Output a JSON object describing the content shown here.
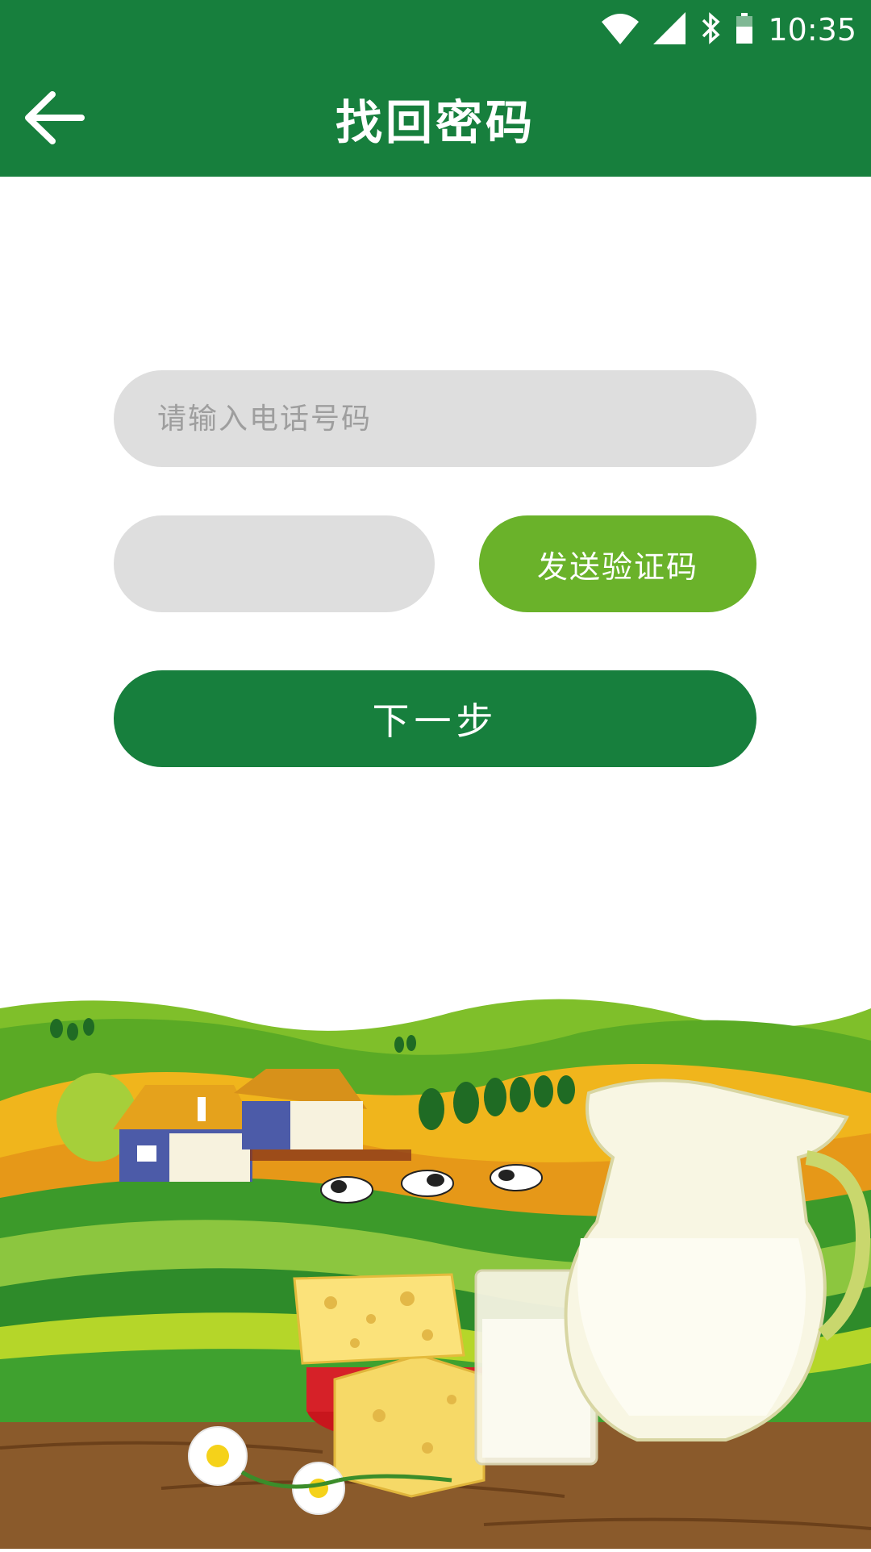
{
  "status_bar": {
    "time": "10:35",
    "icons": [
      "wifi-icon",
      "cell-signal-icon",
      "bluetooth-icon",
      "battery-icon"
    ]
  },
  "app_bar": {
    "title": "找回密码",
    "back_icon": "arrow-left-icon"
  },
  "form": {
    "phone_placeholder": "请输入电话号码",
    "phone_value": "",
    "code_placeholder": "",
    "code_value": "",
    "send_code_label": "发送验证码",
    "next_label": "下一步"
  },
  "colors": {
    "primary": "#177f3d",
    "accent": "#6ab22a",
    "field_bg": "#dedede"
  }
}
